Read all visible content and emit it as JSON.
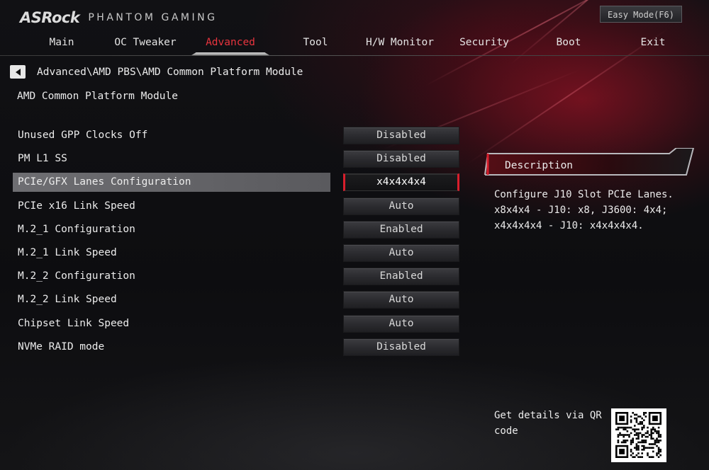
{
  "header": {
    "brand": "ASRock",
    "subtitle": "PHANTOM GAMING",
    "easy_mode_label": "Easy Mode(F6)"
  },
  "nav": {
    "tabs": [
      {
        "label": "Main"
      },
      {
        "label": "OC Tweaker"
      },
      {
        "label": "Advanced",
        "active": true
      },
      {
        "label": "Tool"
      },
      {
        "label": "H/W Monitor"
      },
      {
        "label": "Security"
      },
      {
        "label": "Boot"
      },
      {
        "label": "Exit"
      }
    ]
  },
  "breadcrumb": "Advanced\\AMD PBS\\AMD Common Platform Module",
  "section_title": "AMD Common Platform Module",
  "settings": [
    {
      "label": "Unused GPP Clocks Off",
      "value": "Disabled"
    },
    {
      "label": "PM L1 SS",
      "value": "Disabled"
    },
    {
      "label": "PCIe/GFX Lanes Configuration",
      "value": "x4x4x4x4",
      "selected": true
    },
    {
      "label": "PCIe x16 Link Speed",
      "value": "Auto"
    },
    {
      "label": "M.2_1 Configuration",
      "value": "Enabled"
    },
    {
      "label": "M.2_1 Link Speed",
      "value": "Auto"
    },
    {
      "label": "M.2_2 Configuration",
      "value": "Enabled"
    },
    {
      "label": "M.2_2 Link Speed",
      "value": "Auto"
    },
    {
      "label": "Chipset Link Speed",
      "value": "Auto"
    },
    {
      "label": "NVMe RAID mode",
      "value": "Disabled"
    }
  ],
  "description": {
    "title": "Description",
    "lines": [
      "Configure J10 Slot PCIe Lanes.",
      "x8x4x4 - J10: x8, J3600: 4x4;",
      "x4x4x4x4 - J10: x4x4x4x4."
    ]
  },
  "qr": {
    "text": "Get details via QR code"
  },
  "colors": {
    "accent_red": "#d81e2c",
    "active_tab": "#e8343e",
    "selected_row": "#6e6e72"
  }
}
